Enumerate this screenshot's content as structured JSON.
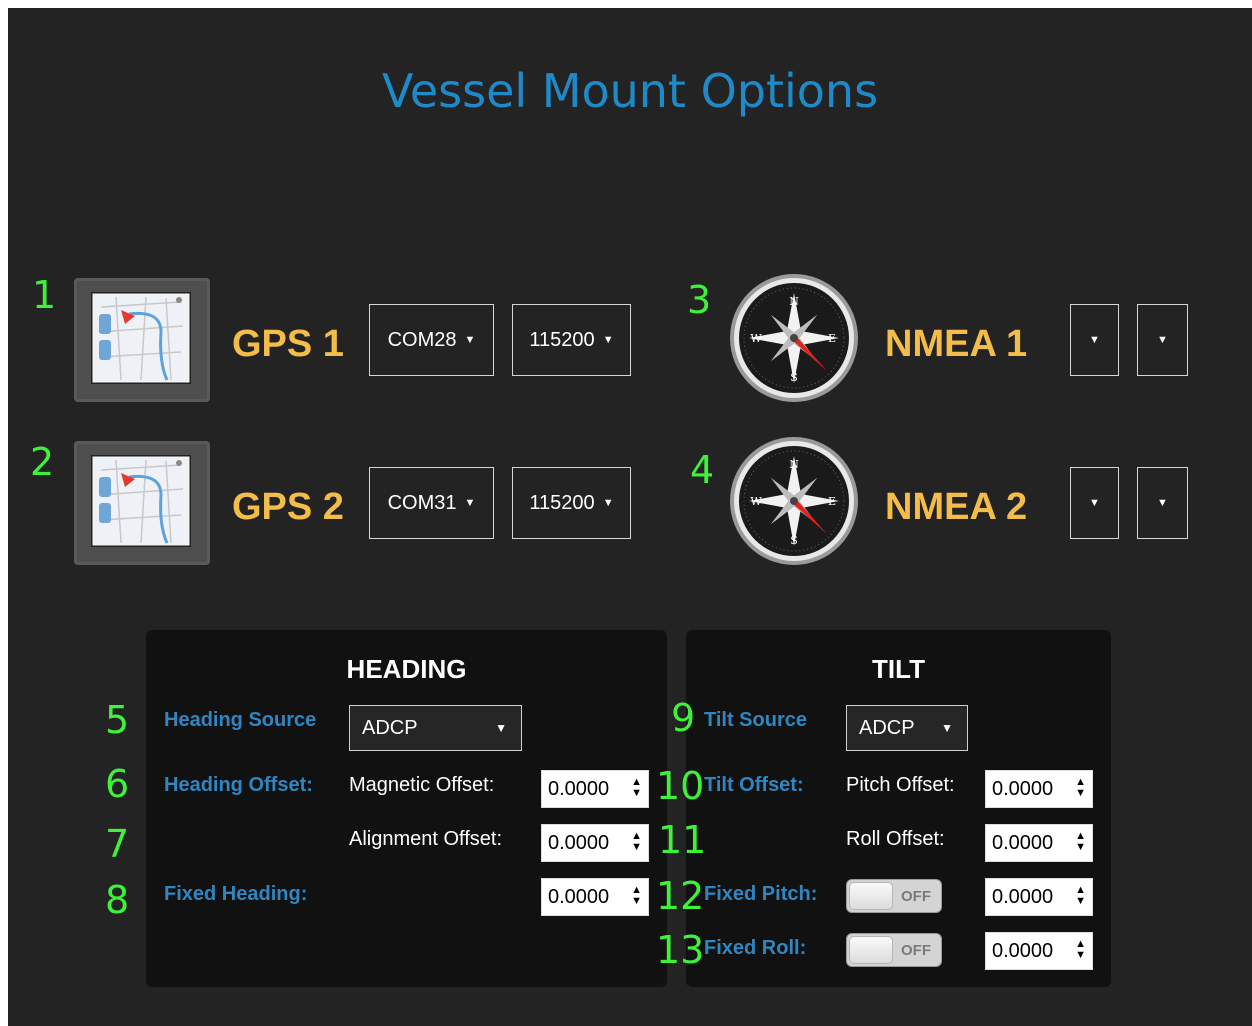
{
  "title": "Vessel Mount Options",
  "devices": [
    {
      "number": "1",
      "label": "GPS 1",
      "port": "COM28",
      "baud": "115200",
      "icon": "gps-map-icon"
    },
    {
      "number": "2",
      "label": "GPS 2",
      "port": "COM31",
      "baud": "115200",
      "icon": "gps-map-icon"
    },
    {
      "number": "3",
      "label": "NMEA 1",
      "port": "",
      "baud": "",
      "icon": "compass-icon"
    },
    {
      "number": "4",
      "label": "NMEA 2",
      "port": "",
      "baud": "",
      "icon": "compass-icon"
    }
  ],
  "heading": {
    "title": "HEADING",
    "source_label": "Heading Source",
    "source_value": "ADCP",
    "offset_label": "Heading Offset:",
    "magnetic_label": "Magnetic Offset:",
    "magnetic_value": "0.0000",
    "alignment_label": "Alignment Offset:",
    "alignment_value": "0.0000",
    "fixed_label": "Fixed Heading:",
    "fixed_value": "0.0000",
    "numbers": [
      "5",
      "6",
      "7",
      "8"
    ]
  },
  "tilt": {
    "title": "TILT",
    "source_label": "Tilt Source",
    "source_value": "ADCP",
    "offset_label": "Tilt Offset:",
    "pitch_label": "Pitch Offset:",
    "pitch_value": "0.0000",
    "roll_label": "Roll Offset:",
    "roll_value": "0.0000",
    "fixed_pitch_label": "Fixed Pitch:",
    "fixed_pitch_toggle": "OFF",
    "fixed_pitch_value": "0.0000",
    "fixed_roll_label": "Fixed Roll:",
    "fixed_roll_toggle": "OFF",
    "fixed_roll_value": "0.0000",
    "numbers": [
      "9",
      "10",
      "11",
      "12",
      "13"
    ]
  },
  "colors": {
    "background": "#232323",
    "title": "#1f8ac9",
    "device_label": "#f4bd49",
    "annotation_number": "#3ef23a",
    "field_label": "#2f86c0"
  },
  "compass_letters": {
    "n": "N",
    "s": "S",
    "e": "E",
    "w": "W"
  }
}
